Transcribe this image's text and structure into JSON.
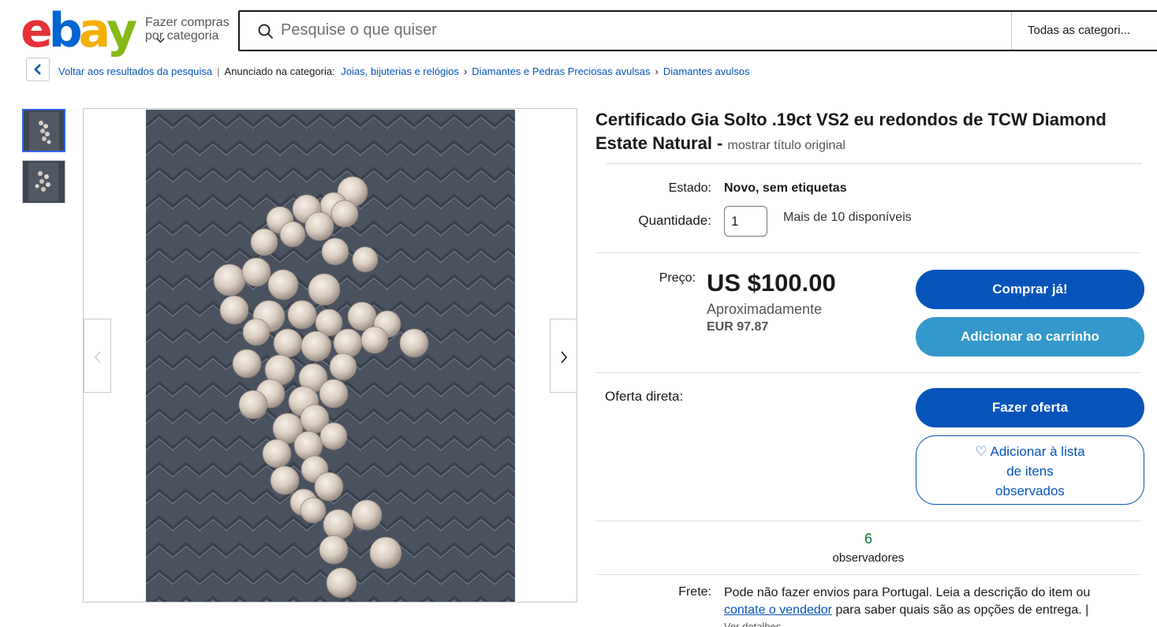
{
  "header": {
    "logo_letters": [
      "e",
      "b",
      "a",
      "y"
    ],
    "logo_colors": [
      "#e53238",
      "#0064d2",
      "#f5af02",
      "#86b817"
    ],
    "shop_by_category": "Fazer compras por categoria",
    "search_placeholder": "Pesquise o que quiser",
    "category_select": "Todas as categori..."
  },
  "breadcrumb": {
    "back_label": "Voltar aos resultados da pesquisa",
    "listed_in": "Anunciado na categoria:",
    "items": [
      "Joias, bijuterias e relógios",
      "Diamantes e Pedras Preciosas avulsas",
      "Diamantes avulsos"
    ]
  },
  "item": {
    "title": "Certificado Gia Solto .19ct VS2 eu redondos de TCW Diamond Estate Natural -",
    "show_original": "mostrar título original",
    "condition_label": "Estado:",
    "condition_value": "Novo, sem etiquetas",
    "quantity_label": "Quantidade:",
    "quantity_value": "1",
    "availability": "Mais de 10 disponíveis",
    "price_label": "Preço:",
    "price": "US $100.00",
    "approx_label": "Aproximadamente",
    "approx_value": "EUR 97.87",
    "best_offer_label": "Oferta direta:",
    "watchers_count": "6",
    "watchers_label": "observadores",
    "shipping_label": "Frete:",
    "shipping_text_1": "Pode não fazer envios para Portugal. Leia a descrição do item ou",
    "shipping_link": "contate o vendedor",
    "shipping_text_2": "para saber quais são as opções de entrega. |",
    "see_details": "Ver detalhes"
  },
  "buttons": {
    "buy_now": "Comprar já!",
    "add_to_cart": "Adicionar ao carrinho",
    "make_offer": "Fazer oferta",
    "watchlist_line1": "Adicionar à lista",
    "watchlist_line2": "de itens",
    "watchlist_line3": "observados"
  },
  "colors": {
    "primary_blue": "#0654ba",
    "light_blue": "#3498ca",
    "watchers_green": "#0b7a32"
  }
}
